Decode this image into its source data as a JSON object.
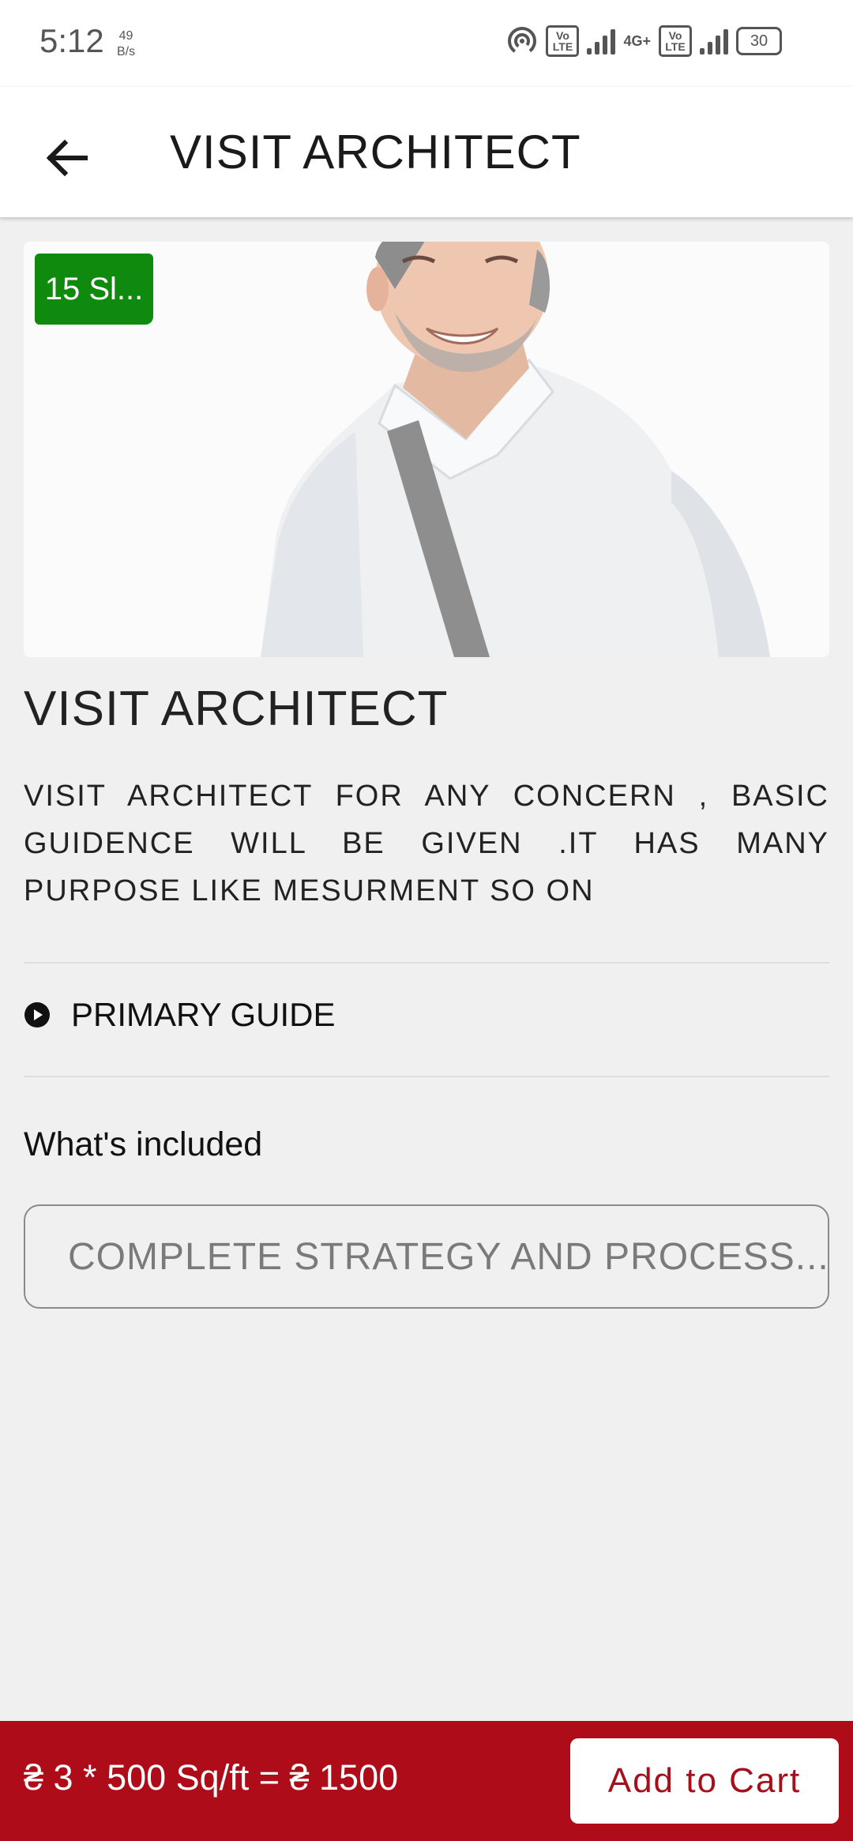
{
  "status_bar": {
    "time": "5:12",
    "data_rate_value": "49",
    "data_rate_unit": "B/s",
    "network_label": "4G+",
    "volte_1": "Vo LTE",
    "volte_2": "Vo LTE",
    "battery": "30"
  },
  "header": {
    "title": "VISIT ARCHITECT",
    "back_icon": "arrow-left-icon"
  },
  "hero": {
    "badge": "15 Sl..."
  },
  "service": {
    "title": "VISIT ARCHITECT",
    "description": "VISIT ARCHITECT FOR ANY CONCERN , BASIC GUIDENCE WILL BE GIVEN .IT HAS MANY PURPOSE LIKE MESURMENT SO ON",
    "guide_label": "PRIMARY GUIDE",
    "guide_icon": "play-circle-icon",
    "included_heading": "What's included",
    "included_items": [
      {
        "label": "COMPLETE STRATEGY AND PROCESS...",
        "icon": "check-circle-icon"
      }
    ]
  },
  "footer": {
    "price_text": "₴ 3 * 500 Sq/ft =  ₴ 1500",
    "add_to_cart": "Add to Cart"
  },
  "colors": {
    "accent": "#ad0c18",
    "badge": "#0f8a0f",
    "check": "#1f8a2e"
  }
}
